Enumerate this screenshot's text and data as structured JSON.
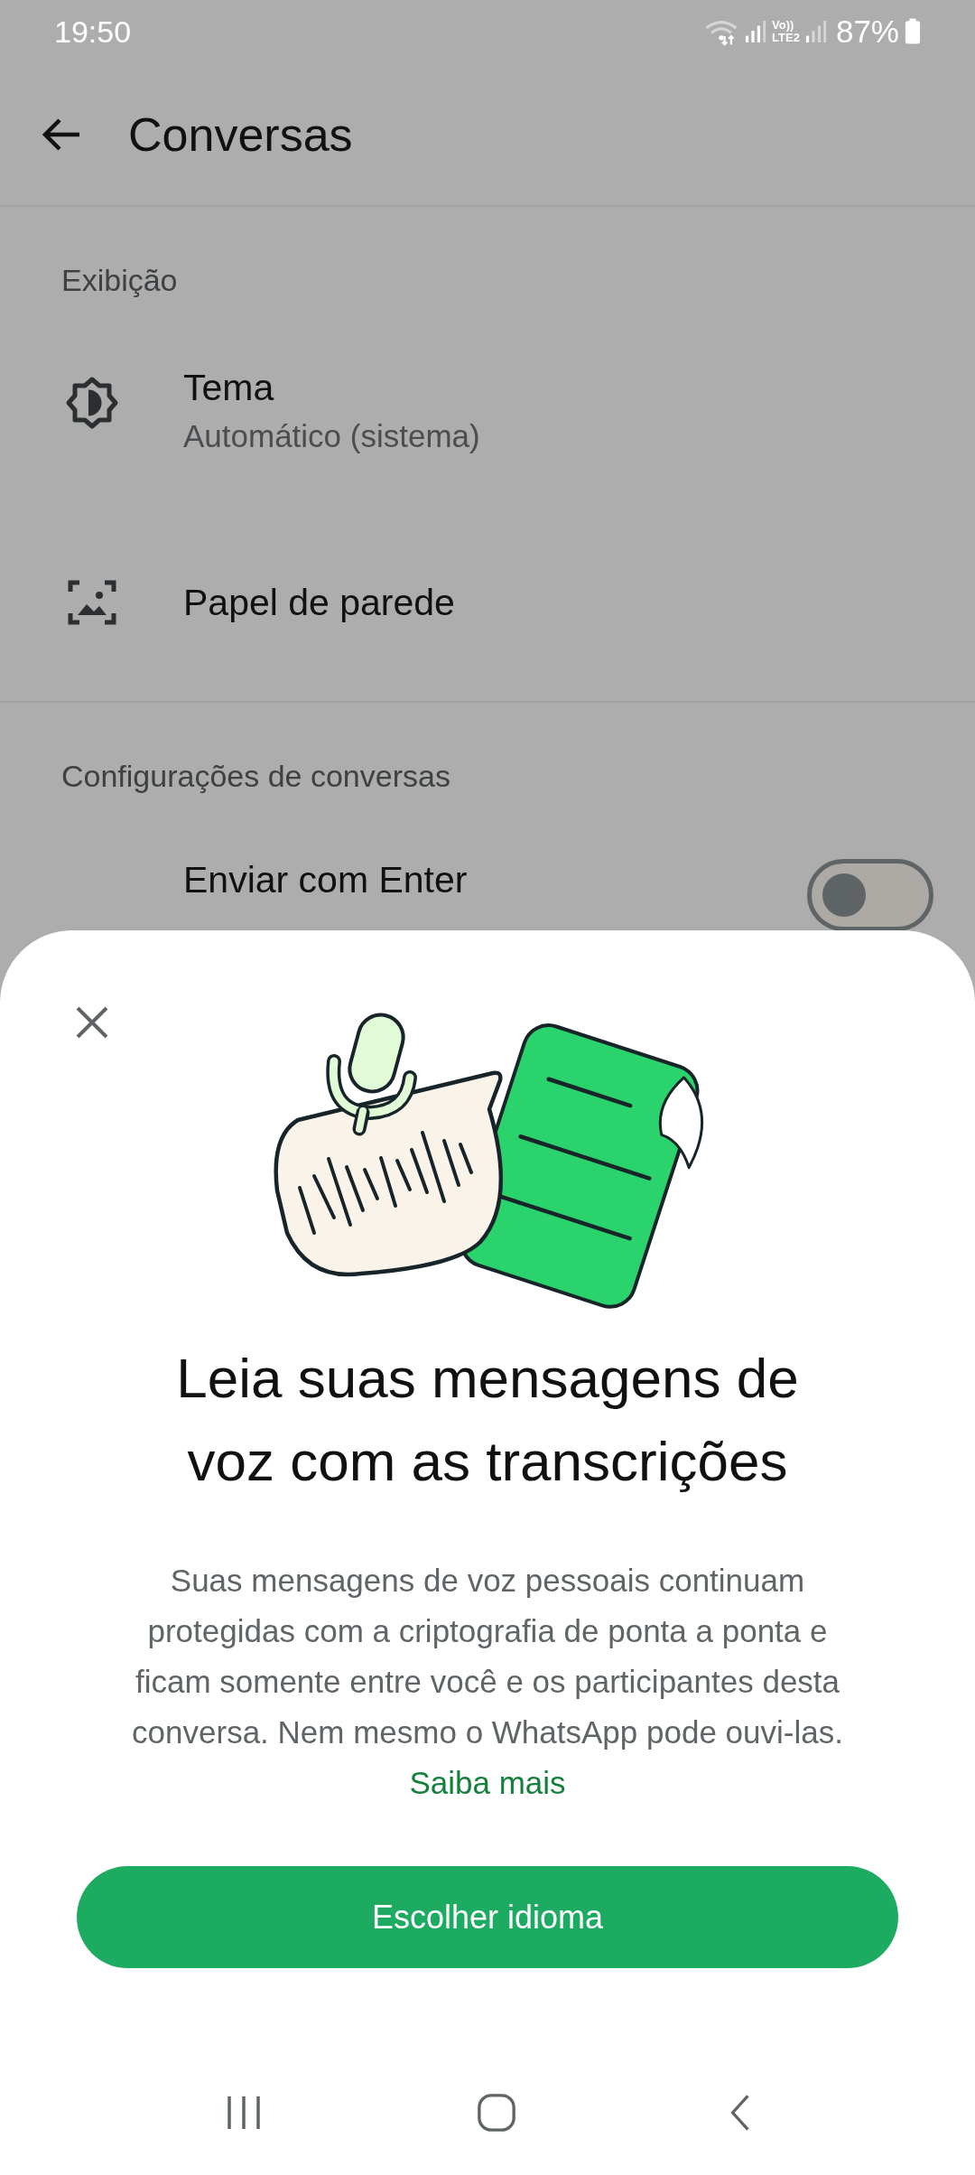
{
  "status_bar": {
    "time": "19:50",
    "volte": [
      "Vo))",
      "LTE2"
    ],
    "battery": "87%"
  },
  "app_bar": {
    "title": "Conversas"
  },
  "sections": [
    {
      "header": "Exibição",
      "items": [
        {
          "kind": "theme",
          "title": "Tema",
          "subtitle": "Automático (sistema)"
        },
        {
          "kind": "wallpaper",
          "title": "Papel de parede"
        }
      ]
    },
    {
      "header": "Configurações de conversas",
      "items": [
        {
          "kind": "toggle",
          "title": "Enviar com Enter",
          "on": false
        }
      ]
    }
  ],
  "sheet": {
    "title_lines": [
      "Leia suas mensagens de",
      "voz com as transcrições"
    ],
    "body": "Suas mensagens de voz pessoais continuam protegidas com a criptografia de ponta a ponta e ficam somente entre você e os participantes desta conversa. Nem mesmo o WhatsApp pode ouvi-las.",
    "link": "Saiba mais",
    "button": "Escolher idioma"
  }
}
